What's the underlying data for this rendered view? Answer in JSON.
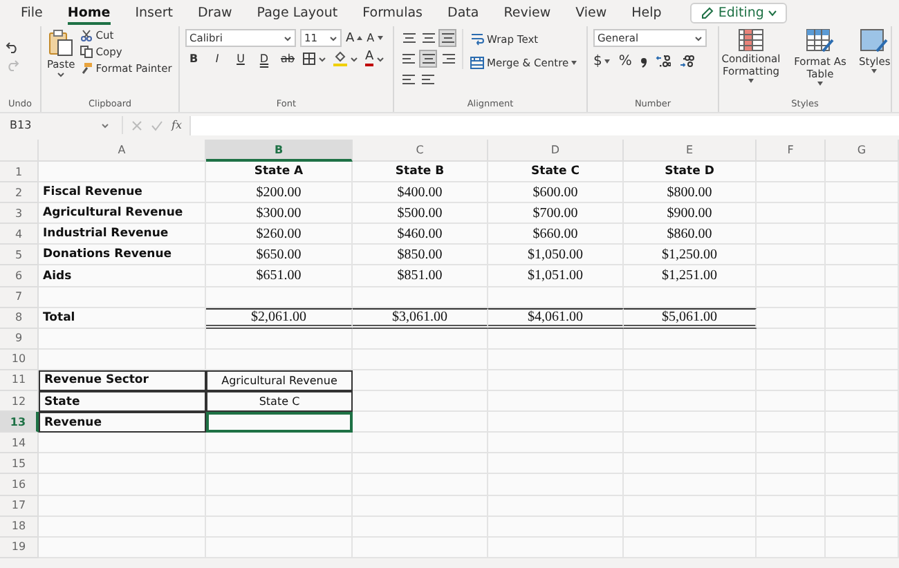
{
  "menu_tabs": [
    {
      "label": "File",
      "selected": false
    },
    {
      "label": "Home",
      "selected": true
    },
    {
      "label": "Insert",
      "selected": false
    },
    {
      "label": "Draw",
      "selected": false
    },
    {
      "label": "Page Layout",
      "selected": false
    },
    {
      "label": "Formulas",
      "selected": false
    },
    {
      "label": "Data",
      "selected": false
    },
    {
      "label": "Review",
      "selected": false
    },
    {
      "label": "View",
      "selected": false
    },
    {
      "label": "Help",
      "selected": false
    }
  ],
  "mode_button": {
    "label": "Editing"
  },
  "ribbon": {
    "undo": {
      "label": "Undo",
      "redo_disabled": true
    },
    "clipboard": {
      "paste": "Paste",
      "items": [
        "Cut",
        "Copy",
        "Format Painter"
      ],
      "label": "Clipboard"
    },
    "font": {
      "name": "Calibri",
      "size": "11",
      "size_buttons": [
        "A",
        "A"
      ],
      "style_buttons": [
        "B",
        "I",
        "U",
        "D"
      ],
      "strikethrough": "ab",
      "font_color": "A",
      "label": "Font"
    },
    "alignment": {
      "wrap_text": "Wrap Text",
      "merge": "Merge & Centre",
      "label": "Alignment"
    },
    "number": {
      "format": "General",
      "currency": "$",
      "percent": "%",
      "label": "Number"
    },
    "styles": {
      "buttons": [
        "Conditional Formatting",
        "Format As Table",
        "Styles"
      ],
      "label": "Styles"
    }
  },
  "formula_bar": {
    "name_box": "B13",
    "function_label": "fx"
  },
  "sheet": {
    "columns": [
      {
        "label": "A",
        "selected": false
      },
      {
        "label": "B",
        "selected": true
      },
      {
        "label": "C",
        "selected": false
      },
      {
        "label": "D",
        "selected": false
      },
      {
        "label": "E",
        "selected": false
      },
      {
        "label": "F",
        "selected": false
      },
      {
        "label": "G",
        "selected": false
      }
    ],
    "rows": [
      {
        "number": "1",
        "kind": "header",
        "selected": false,
        "cells": [
          null,
          "State A",
          "State B",
          "State C",
          "State D"
        ]
      },
      {
        "number": "2",
        "kind": "data",
        "selected": false,
        "cells": [
          "Fiscal Revenue",
          "$200.00",
          "$400.00",
          "$600.00",
          "$800.00"
        ]
      },
      {
        "number": "3",
        "kind": "data",
        "selected": false,
        "cells": [
          "Agricultural Revenue",
          "$300.00",
          "$500.00",
          "$700.00",
          "$900.00"
        ]
      },
      {
        "number": "4",
        "kind": "data",
        "selected": false,
        "cells": [
          "Industrial Revenue",
          "$260.00",
          "$460.00",
          "$660.00",
          "$860.00"
        ]
      },
      {
        "number": "5",
        "kind": "data",
        "selected": false,
        "cells": [
          "Donations Revenue",
          "$650.00",
          "$850.00",
          "$1,050.00",
          "$1,250.00"
        ]
      },
      {
        "number": "6",
        "kind": "data",
        "selected": false,
        "cells": [
          "Aids",
          "$651.00",
          "$851.00",
          "$1,051.00",
          "$1,251.00"
        ]
      },
      {
        "number": "7",
        "kind": "blank",
        "selected": false
      },
      {
        "number": "8",
        "kind": "total",
        "selected": false,
        "cells": [
          "Total",
          "$2,061.00",
          "$3,061.00",
          "$4,061.00",
          "$5,061.00"
        ]
      },
      {
        "number": "9",
        "kind": "blank",
        "selected": false
      },
      {
        "number": "10",
        "kind": "blank",
        "selected": false
      },
      {
        "number": "11",
        "kind": "lookup",
        "selected": false,
        "cells": [
          "Revenue Sector",
          "Agricultural Revenue"
        ]
      },
      {
        "number": "12",
        "kind": "lookup",
        "selected": false,
        "cells": [
          "State",
          "State C"
        ]
      },
      {
        "number": "13",
        "kind": "lookup",
        "selected": true,
        "cells": [
          "Revenue"
        ]
      },
      {
        "number": "14",
        "kind": "blank",
        "selected": false
      },
      {
        "number": "15",
        "kind": "blank",
        "selected": false
      },
      {
        "number": "16",
        "kind": "blank",
        "selected": false
      },
      {
        "number": "17",
        "kind": "blank",
        "selected": false
      },
      {
        "number": "18",
        "kind": "blank",
        "selected": false
      },
      {
        "number": "19",
        "kind": "blank",
        "selected": false
      }
    ]
  }
}
